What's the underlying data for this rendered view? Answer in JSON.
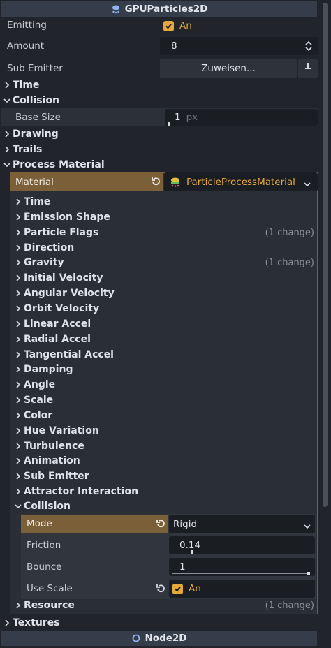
{
  "header": {
    "title": "GPUParticles2D",
    "icon": "particles-icon"
  },
  "properties": {
    "emitting": {
      "label": "Emitting",
      "value": "An"
    },
    "amount": {
      "label": "Amount",
      "value": "8"
    },
    "sub_emitter": {
      "label": "Sub Emitter",
      "button": "Zuweisen..."
    }
  },
  "sections": {
    "time": "Time",
    "collision": "Collision",
    "base_size": {
      "label": "Base Size",
      "value": "1",
      "unit": "px"
    },
    "drawing": "Drawing",
    "trails": "Trails",
    "process_material": "Process Material"
  },
  "material": {
    "label": "Material",
    "value": "ParticleProcessMaterial"
  },
  "material_items": [
    {
      "label": "Time",
      "note": ""
    },
    {
      "label": "Emission Shape",
      "note": ""
    },
    {
      "label": "Particle Flags",
      "note": "(1 change)"
    },
    {
      "label": "Direction",
      "note": ""
    },
    {
      "label": "Gravity",
      "note": "(1 change)"
    },
    {
      "label": "Initial Velocity",
      "note": ""
    },
    {
      "label": "Angular Velocity",
      "note": ""
    },
    {
      "label": "Orbit Velocity",
      "note": ""
    },
    {
      "label": "Linear Accel",
      "note": ""
    },
    {
      "label": "Radial Accel",
      "note": ""
    },
    {
      "label": "Tangential Accel",
      "note": ""
    },
    {
      "label": "Damping",
      "note": ""
    },
    {
      "label": "Angle",
      "note": ""
    },
    {
      "label": "Scale",
      "note": ""
    },
    {
      "label": "Color",
      "note": ""
    },
    {
      "label": "Hue Variation",
      "note": ""
    },
    {
      "label": "Turbulence",
      "note": ""
    },
    {
      "label": "Animation",
      "note": ""
    },
    {
      "label": "Sub Emitter",
      "note": ""
    },
    {
      "label": "Attractor Interaction",
      "note": ""
    }
  ],
  "collision_sub": {
    "title": "Collision",
    "mode": {
      "label": "Mode",
      "value": "Rigid"
    },
    "friction": {
      "label": "Friction",
      "value": "0.14"
    },
    "bounce": {
      "label": "Bounce",
      "value": "1"
    },
    "use_scale": {
      "label": "Use Scale",
      "value": "An"
    }
  },
  "resource": {
    "label": "Resource",
    "note": "(1 change)"
  },
  "textures": "Textures",
  "footer": {
    "title": "Node2D"
  },
  "colors": {
    "accent": "#e5a83a",
    "highlight_row": "#7a5f39",
    "panel_bg": "#21252b",
    "field_bg": "#1a1d22"
  }
}
